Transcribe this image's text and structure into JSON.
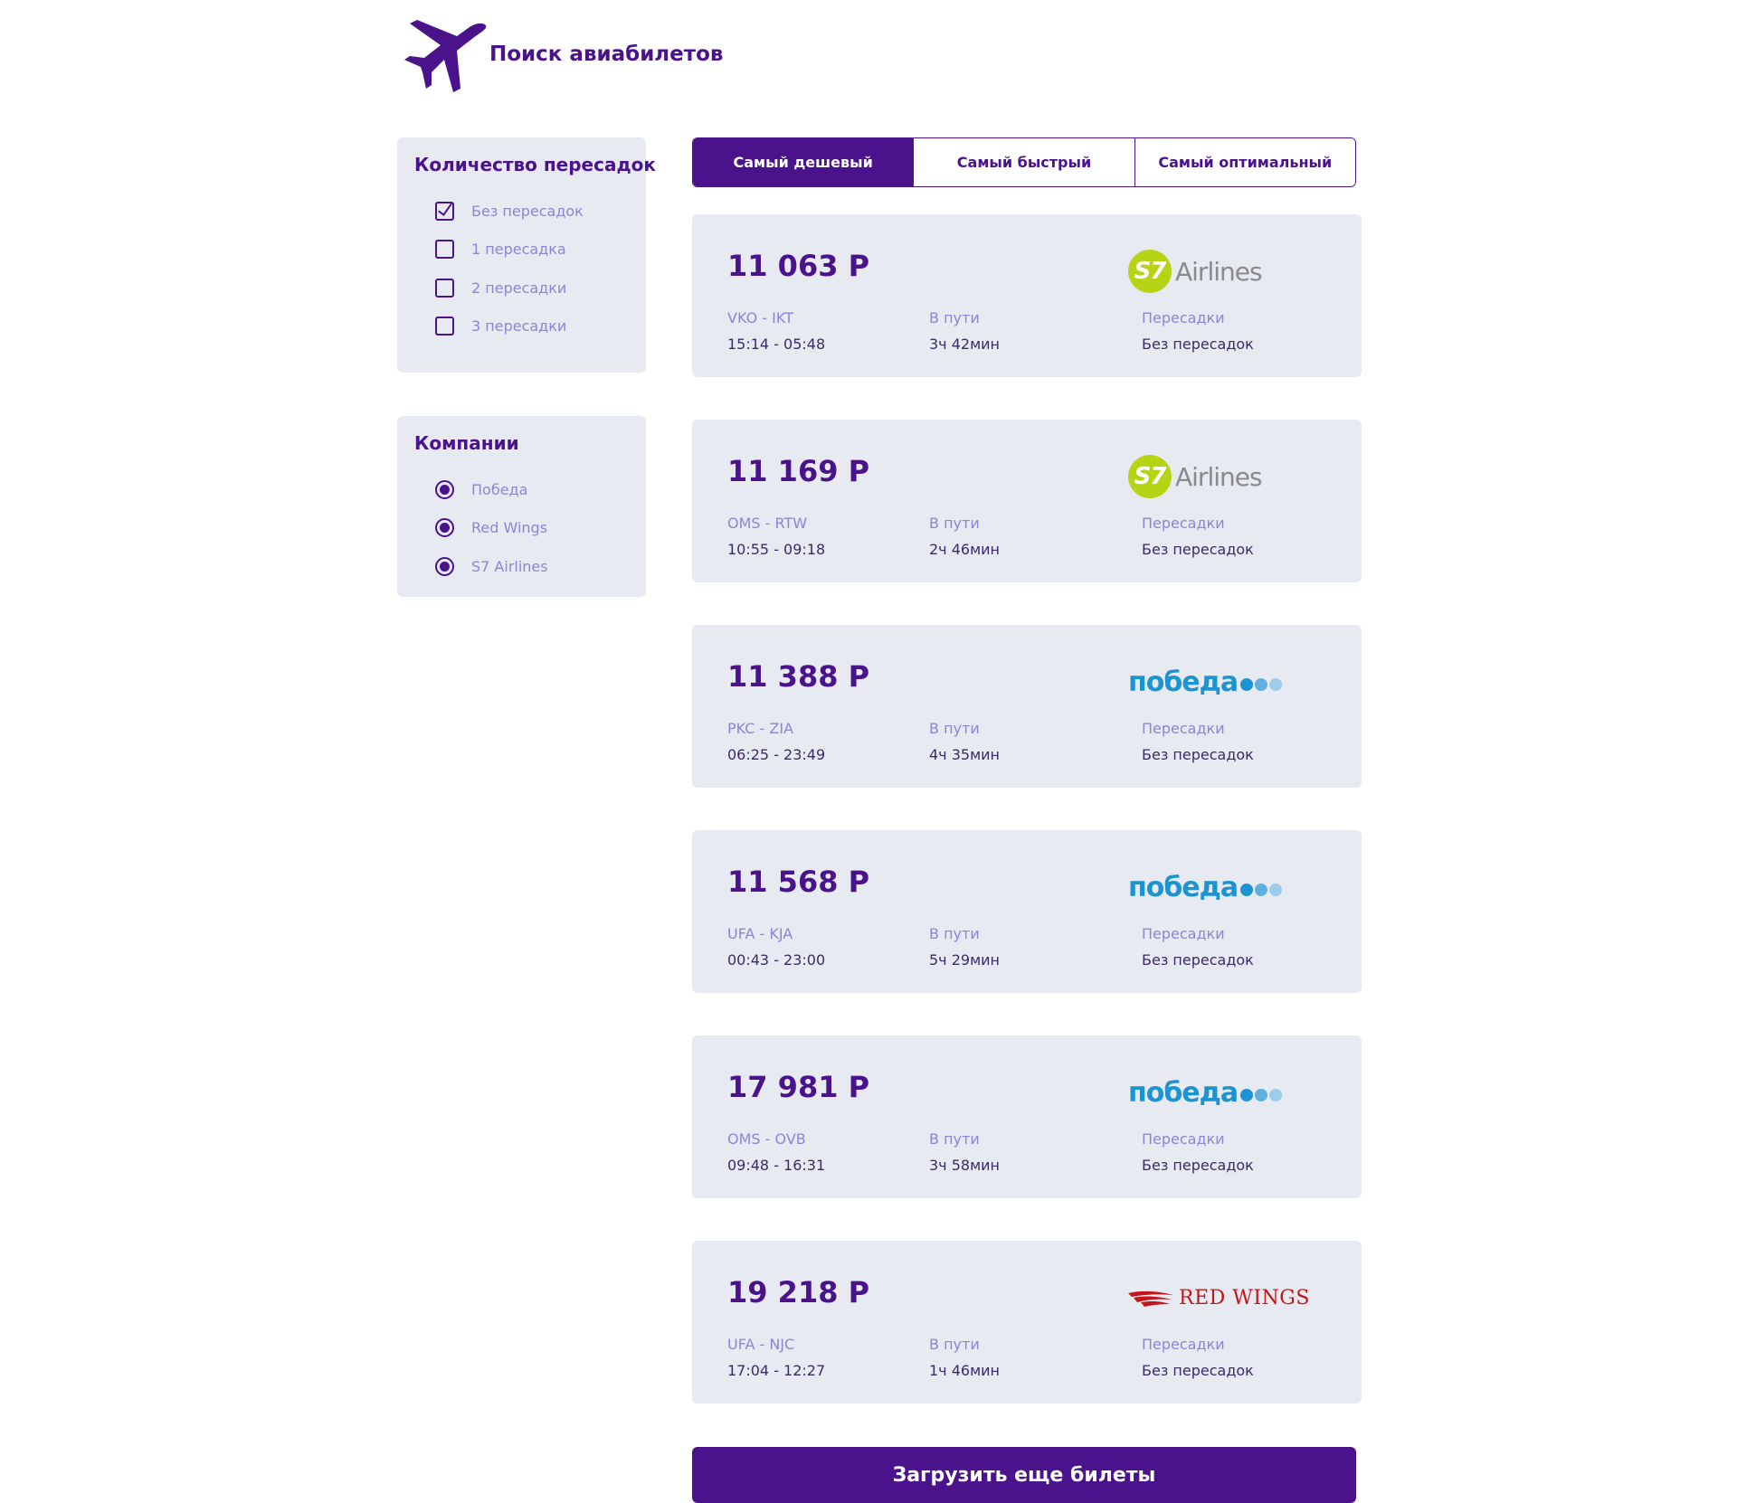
{
  "header": {
    "title": "Поиск авиабилетов",
    "logo_icon": "airplane-icon"
  },
  "filters": {
    "transfers": {
      "title": "Количество пересадок",
      "options": [
        {
          "label": "Без пересадок",
          "checked": true
        },
        {
          "label": "1 пересадка",
          "checked": false
        },
        {
          "label": "2 пересадки",
          "checked": false
        },
        {
          "label": "3 пересадки",
          "checked": false
        }
      ]
    },
    "companies": {
      "title": "Компании",
      "options": [
        {
          "label": "Победа",
          "checked": true
        },
        {
          "label": "Red Wings",
          "checked": true
        },
        {
          "label": "S7 Airlines",
          "checked": true
        }
      ]
    }
  },
  "sort_tabs": [
    {
      "label": "Самый дешевый",
      "active": true
    },
    {
      "label": "Самый быстрый",
      "active": false
    },
    {
      "label": "Самый оптимальный",
      "active": false
    }
  ],
  "labels": {
    "duration": "В пути",
    "stops": "Пересадки"
  },
  "logos": {
    "s7_mark": "S7",
    "s7_text": "Airlines",
    "pobeda_text": "победа",
    "redwings_text": "RED WINGS"
  },
  "tickets": [
    {
      "price": "11 063 Р",
      "carrier": "s7",
      "route": "VKO - IKT",
      "time": "15:14 - 05:48",
      "duration": "3ч 42мин",
      "stops": "Без пересадок"
    },
    {
      "price": "11 169 Р",
      "carrier": "s7",
      "route": "OMS - RTW",
      "time": "10:55 - 09:18",
      "duration": "2ч 46мин",
      "stops": "Без пересадок"
    },
    {
      "price": "11 388 Р",
      "carrier": "pobeda",
      "route": "PKC - ZIA",
      "time": "06:25 - 23:49",
      "duration": "4ч 35мин",
      "stops": "Без пересадок"
    },
    {
      "price": "11 568 Р",
      "carrier": "pobeda",
      "route": "UFA - KJA",
      "time": "00:43 - 23:00",
      "duration": "5ч 29мин",
      "stops": "Без пересадок"
    },
    {
      "price": "17 981 Р",
      "carrier": "pobeda",
      "route": "OMS - OVB",
      "time": "09:48 - 16:31",
      "duration": "3ч 58мин",
      "stops": "Без пересадок"
    },
    {
      "price": "19 218 Р",
      "carrier": "redwings",
      "route": "UFA - NJC",
      "time": "17:04 - 12:27",
      "duration": "1ч 46мин",
      "stops": "Без пересадок"
    }
  ],
  "load_more": {
    "label": "Загрузить еще билеты"
  },
  "colors": {
    "brand": "#4a138c",
    "panel_bg": "#e8eaf2",
    "muted_text": "#8b85d6",
    "s7_green": "#b6d316",
    "pobeda_blue": "#1d94d2",
    "redwings_red": "#c3161c"
  }
}
